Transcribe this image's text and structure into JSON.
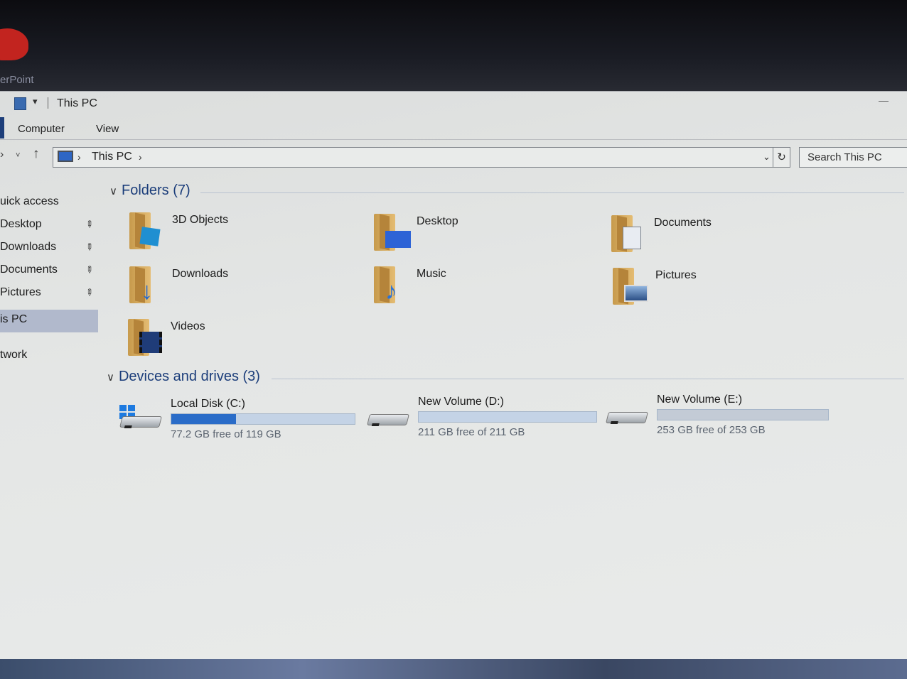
{
  "app_label": "erPoint",
  "window": {
    "title": "This PC"
  },
  "ribbon": {
    "tabs": [
      "Computer",
      "View"
    ]
  },
  "address_bar": {
    "path": "This PC",
    "search_placeholder": "Search This PC"
  },
  "sidebar": {
    "items": [
      {
        "label": "uick access",
        "pinned": false
      },
      {
        "label": "Desktop",
        "pinned": true
      },
      {
        "label": "Downloads",
        "pinned": true
      },
      {
        "label": "Documents",
        "pinned": true
      },
      {
        "label": "Pictures",
        "pinned": true
      },
      {
        "label": "is PC",
        "pinned": false,
        "selected": true
      },
      {
        "label": "twork",
        "pinned": false
      }
    ]
  },
  "folders": {
    "header": "Folders (7)",
    "items": [
      {
        "label": "3D Objects",
        "icon": "3d-objects-folder-icon",
        "accent": "#1f8fd1"
      },
      {
        "label": "Desktop",
        "icon": "desktop-folder-icon",
        "accent": "#2d63d6"
      },
      {
        "label": "Documents",
        "icon": "documents-folder-icon",
        "accent": "#e8ecf2"
      },
      {
        "label": "Downloads",
        "icon": "downloads-folder-icon",
        "accent": "#2268d2"
      },
      {
        "label": "Music",
        "icon": "music-folder-icon",
        "accent": "#2a73d8"
      },
      {
        "label": "Pictures",
        "icon": "pictures-folder-icon",
        "accent": "#3b6fae"
      },
      {
        "label": "Videos",
        "icon": "videos-folder-icon",
        "accent": "#1f3c78"
      }
    ]
  },
  "drives": {
    "header": "Devices and drives (3)",
    "items": [
      {
        "name": "Local Disk (C:)",
        "free_text": "77.2 GB free of 119 GB",
        "used_fraction": 0.351,
        "system": true
      },
      {
        "name": "New Volume (D:)",
        "free_text": "211 GB free of 211 GB",
        "used_fraction": 0.0,
        "system": false
      },
      {
        "name": "New Volume (E:)",
        "free_text": "253 GB free of 253 GB",
        "used_fraction": 0.0,
        "system": false
      }
    ]
  }
}
